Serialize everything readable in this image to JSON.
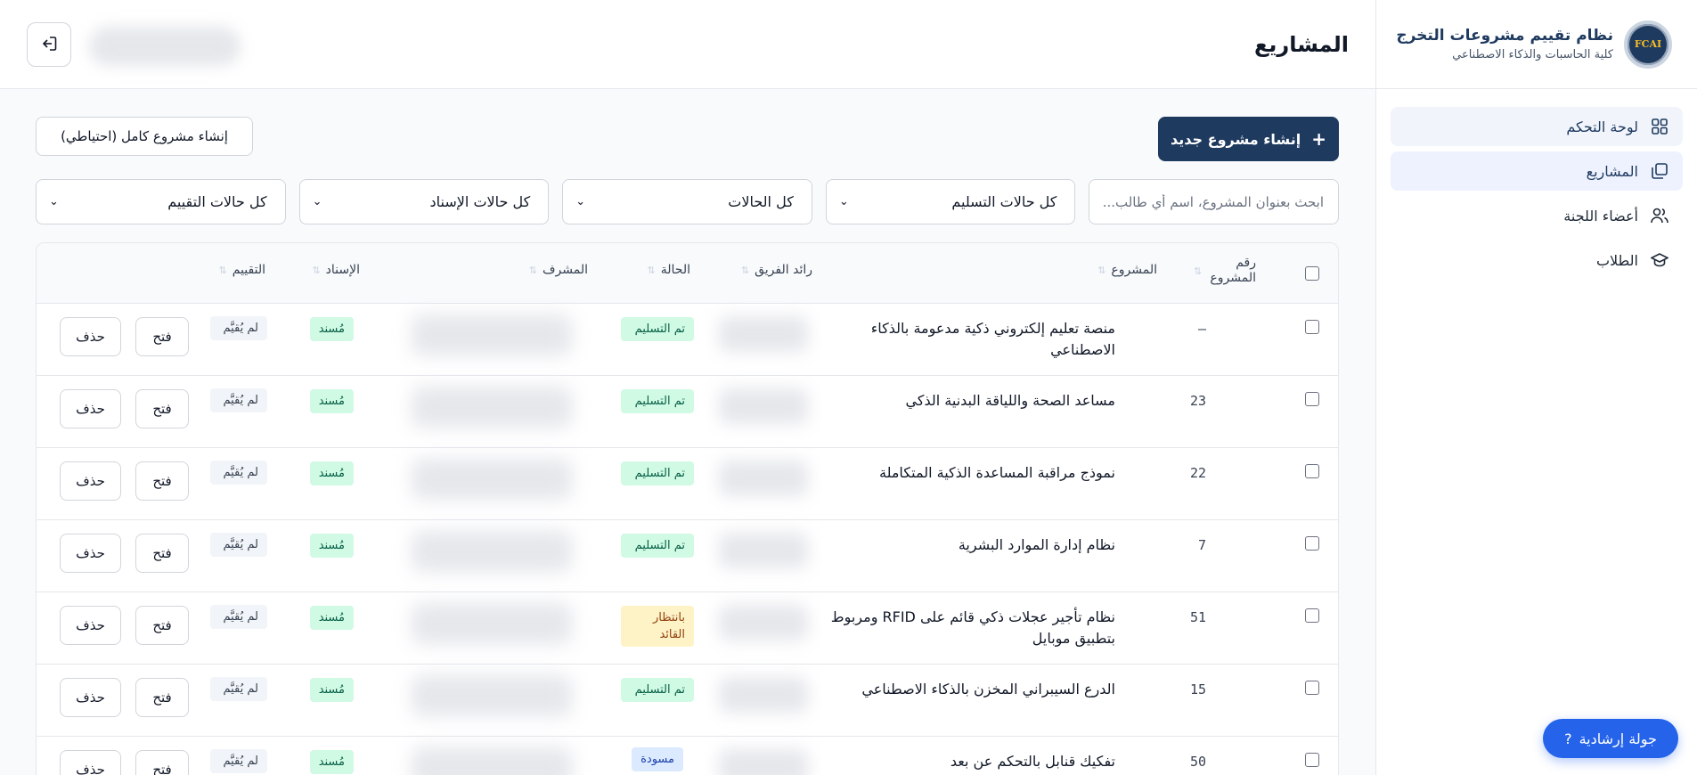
{
  "app": {
    "title": "نظام تقييم مشروعات التخرج",
    "subtitle": "كلية الحاسبات والذكاء الاصطناعي",
    "logo_text": "FCAI"
  },
  "sidebar": {
    "items": [
      {
        "label": "لوحة التحكم",
        "icon": "dashboard-icon"
      },
      {
        "label": "المشاريع",
        "icon": "projects-icon"
      },
      {
        "label": "أعضاء اللجنة",
        "icon": "users-icon"
      },
      {
        "label": "الطلاب",
        "icon": "graduation-cap-icon"
      }
    ]
  },
  "header": {
    "page_title": "المشاريع"
  },
  "toolbar": {
    "new_project_label": "إنشاء مشروع جديد",
    "full_project_label": "إنشاء مشروع كامل (احتياطي)"
  },
  "filters": {
    "search_placeholder": "ابحث بعنوان المشروع، اسم أي طالب...",
    "delivery": "كل حالات التسليم",
    "status": "كل الحالات",
    "assignment": "كل حالات الإسناد",
    "evaluation": "كل حالات التقييم"
  },
  "table": {
    "headers": {
      "number": "رقم المشروع",
      "project": "المشروع",
      "leader": "رائد الفريق",
      "status": "الحالة",
      "supervisor": "المشرف",
      "assignment": "الإسناد",
      "rating": "التقييم"
    },
    "rows": [
      {
        "num": "—",
        "title": "منصة تعليم إلكتروني ذكية مدعومة بالذكاء الاصطناعي",
        "status": "تم التسليم",
        "status_kind": "done",
        "assign": "مُسند",
        "rating": "لم يُقيَّم",
        "open": "فتح",
        "delete": "حذف"
      },
      {
        "num": "23",
        "title": "مساعد الصحة واللياقة البدنية الذكي",
        "status": "تم التسليم",
        "status_kind": "done",
        "assign": "مُسند",
        "rating": "لم يُقيَّم",
        "open": "فتح",
        "delete": "حذف"
      },
      {
        "num": "22",
        "title": "نموذج مراقبة المساعدة الذكية المتكاملة",
        "status": "تم التسليم",
        "status_kind": "done",
        "assign": "مُسند",
        "rating": "لم يُقيَّم",
        "open": "فتح",
        "delete": "حذف"
      },
      {
        "num": "7",
        "title": "نظام إدارة الموارد البشرية",
        "status": "تم التسليم",
        "status_kind": "done",
        "assign": "مُسند",
        "rating": "لم يُقيَّم",
        "open": "فتح",
        "delete": "حذف"
      },
      {
        "num": "51",
        "title": "نظام تأجير عجلات ذكي قائم على RFID ومربوط بتطبيق موبايل",
        "status": "بانتظار القائد",
        "status_kind": "wait",
        "assign": "مُسند",
        "rating": "لم يُقيَّم",
        "open": "فتح",
        "delete": "حذف"
      },
      {
        "num": "15",
        "title": "الدرع السيبراني المخزن بالذكاء الاصطناعي",
        "status": "تم التسليم",
        "status_kind": "done",
        "assign": "مُسند",
        "rating": "لم يُقيَّم",
        "open": "فتح",
        "delete": "حذف"
      },
      {
        "num": "50",
        "title": "تفكيك قنابل بالتحكم عن بعد",
        "status": "مسودة",
        "status_kind": "draft",
        "assign": "مُسند",
        "rating": "لم يُقيَّم",
        "open": "فتح",
        "delete": "حذف"
      }
    ]
  },
  "tour": {
    "label": "جولة إرشادية",
    "icon": "?"
  },
  "colors": {
    "primary": "#1e3a5f",
    "accent": "#2563eb",
    "done_bg": "#d1fae5",
    "wait_bg": "#fef3c7",
    "draft_bg": "#dbeafe"
  }
}
